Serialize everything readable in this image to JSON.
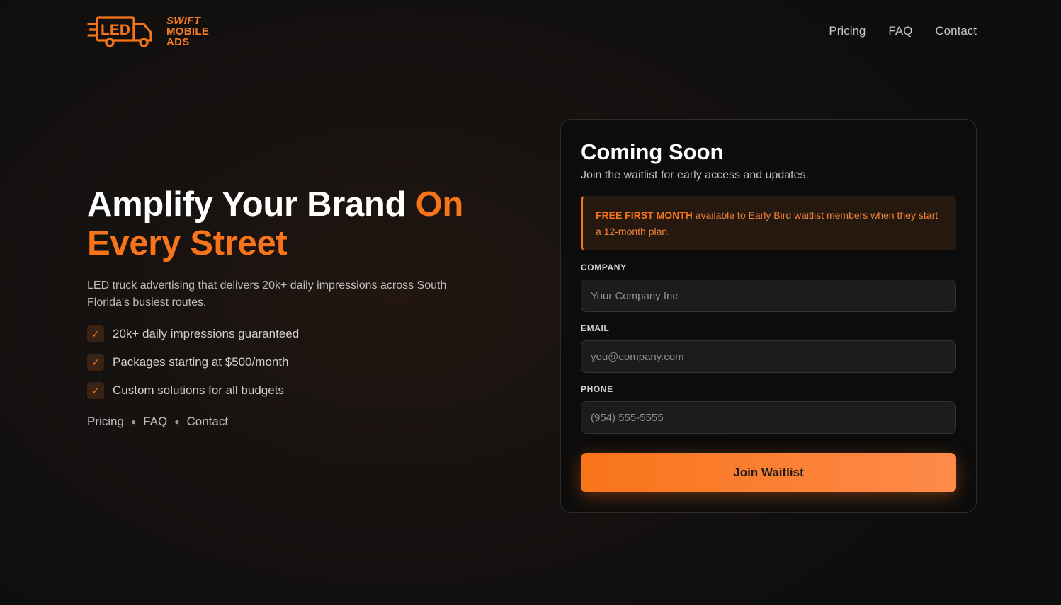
{
  "brand": {
    "logo_text": "LED",
    "name_lines": [
      "SWIFT",
      "MOBILE",
      "ADS"
    ],
    "accent_color": "#f7741a"
  },
  "nav": {
    "items": [
      "Pricing",
      "FAQ",
      "Contact"
    ]
  },
  "hero": {
    "title_main": "Amplify Your Brand ",
    "title_accent_1": "On",
    "title_accent_2": "Every Street",
    "subtitle": "LED truck advertising that delivers 20k+ daily impressions across South Florida's busiest routes.",
    "features": [
      "20k+ daily impressions guaranteed",
      "Packages starting at $500/month",
      "Custom solutions for all budgets"
    ],
    "check_icon": "check-icon",
    "footer_links": [
      "Pricing",
      "FAQ",
      "Contact"
    ]
  },
  "card": {
    "title": "Coming Soon",
    "subtitle": "Join the waitlist for early access and updates.",
    "promo_highlight": "FREE FIRST MONTH",
    "promo_text": " available to Early Bird waitlist members when they start a 12-month plan.",
    "fields": [
      {
        "label": "COMPANY",
        "placeholder": "Your Company Inc"
      },
      {
        "label": "EMAIL",
        "placeholder": "you@company.com"
      },
      {
        "label": "PHONE",
        "placeholder": "(954) 555-5555"
      }
    ],
    "submit_label": "Join Waitlist"
  }
}
